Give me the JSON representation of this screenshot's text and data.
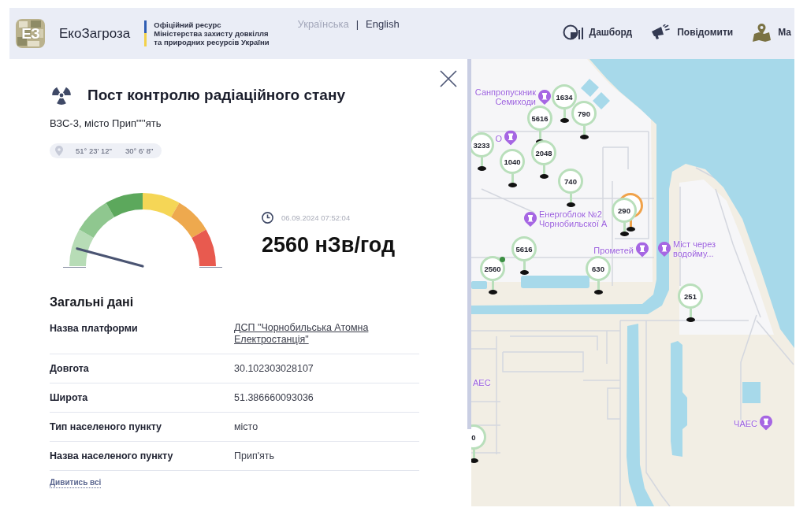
{
  "header": {
    "logo": {
      "mark": "ЕЗ",
      "name": "ЕкоЗагроза"
    },
    "ministry": [
      "Офіційний ресурс",
      "Міністерства захисту довкілля",
      "та природних ресурсів України"
    ],
    "languages": [
      {
        "label": "Українська",
        "selected": true
      },
      {
        "label": "English",
        "selected": false
      }
    ],
    "language_separator": "|",
    "nav": [
      {
        "kind": "dashboard",
        "label": "Дашборд"
      },
      {
        "kind": "report",
        "label": "Повідомити"
      },
      {
        "kind": "map",
        "label": "Ма"
      }
    ]
  },
  "panel": {
    "title": "Пост контролю радіаційного стану",
    "subtitle": "ВЗС-3, місто Прип\"\"'ять",
    "coordinates": {
      "latitude": "51° 23' 12\"",
      "longitude": "30° 6' 8\""
    },
    "gauge": {
      "segments": [
        {
          "color": "#b7dcb6",
          "selected": true
        },
        {
          "color": "#8fc78f",
          "selected": false
        },
        {
          "color": "#5ca85c",
          "selected": false
        },
        {
          "color": "#f5d656",
          "selected": false
        },
        {
          "color": "#eea94e",
          "selected": false
        },
        {
          "color": "#e85a4f",
          "selected": false
        }
      ]
    },
    "measured_at": "06.09.2024 07:52:04",
    "reading": "2560 нЗв/год",
    "section_title": "Загальні дані",
    "rows": [
      {
        "kind": "link",
        "label": "Назва платформи",
        "value": "ДСП \"Чорнобильська Атомна Електростанція\""
      },
      {
        "kind": "text",
        "label": "Довгота",
        "value": "30.102303028107"
      },
      {
        "kind": "text",
        "label": "Широта",
        "value": "51.386660093036"
      },
      {
        "kind": "text",
        "label": "Тип населеного пункту",
        "value": "місто"
      },
      {
        "kind": "text",
        "label": "Назва населеного пункту",
        "value": "Прип'ять"
      }
    ],
    "show_all": "Дивитись всі"
  },
  "map": {
    "pins": [
      {
        "value": "1634",
        "color": "#b9dfbb",
        "selected": false
      },
      {
        "value": "5616",
        "color": "#b9dfbb",
        "selected": false
      },
      {
        "value": "790",
        "color": "#b9dfbb",
        "selected": false
      },
      {
        "value": "3233",
        "color": "#b9dfbb",
        "selected": false
      },
      {
        "value": "2048",
        "color": "#b9dfbb",
        "selected": false
      },
      {
        "value": "1040",
        "color": "#b9dfbb",
        "selected": false
      },
      {
        "value": "740",
        "color": "#b9dfbb",
        "selected": false
      },
      {
        "color": "#f0a24a",
        "selected": false
      },
      {
        "value": "290",
        "color": "#b9dfbb",
        "selected": false
      },
      {
        "value": "5616",
        "color": "#b9dfbb",
        "selected": false
      },
      {
        "value": "2560",
        "color": "#b9dfbb",
        "selected": true
      },
      {
        "value": "630",
        "color": "#b9dfbb",
        "selected": false
      },
      {
        "value": "251",
        "color": "#b9dfbb",
        "selected": false
      },
      {
        "value": "0",
        "color": "#b9dfbb",
        "selected": false
      }
    ],
    "places": [
      {
        "kind": "landmark",
        "label": [
          "Санпропускник",
          "Семиходи"
        ]
      },
      {
        "kind": "landmark",
        "label": [
          "О"
        ]
      },
      {
        "kind": "landmark",
        "label": [
          "Енергоблок №2",
          "Чорнобильскої А"
        ]
      },
      {
        "kind": "landmark",
        "label": [
          "Прометей"
        ]
      },
      {
        "kind": "landmark",
        "label": [
          "Міст через",
          "водойму..."
        ]
      },
      {
        "kind": "landmark",
        "label": [
          "ЧАЕС"
        ]
      },
      {
        "kind": "label",
        "label": [
          "АЕС"
        ]
      }
    ]
  }
}
